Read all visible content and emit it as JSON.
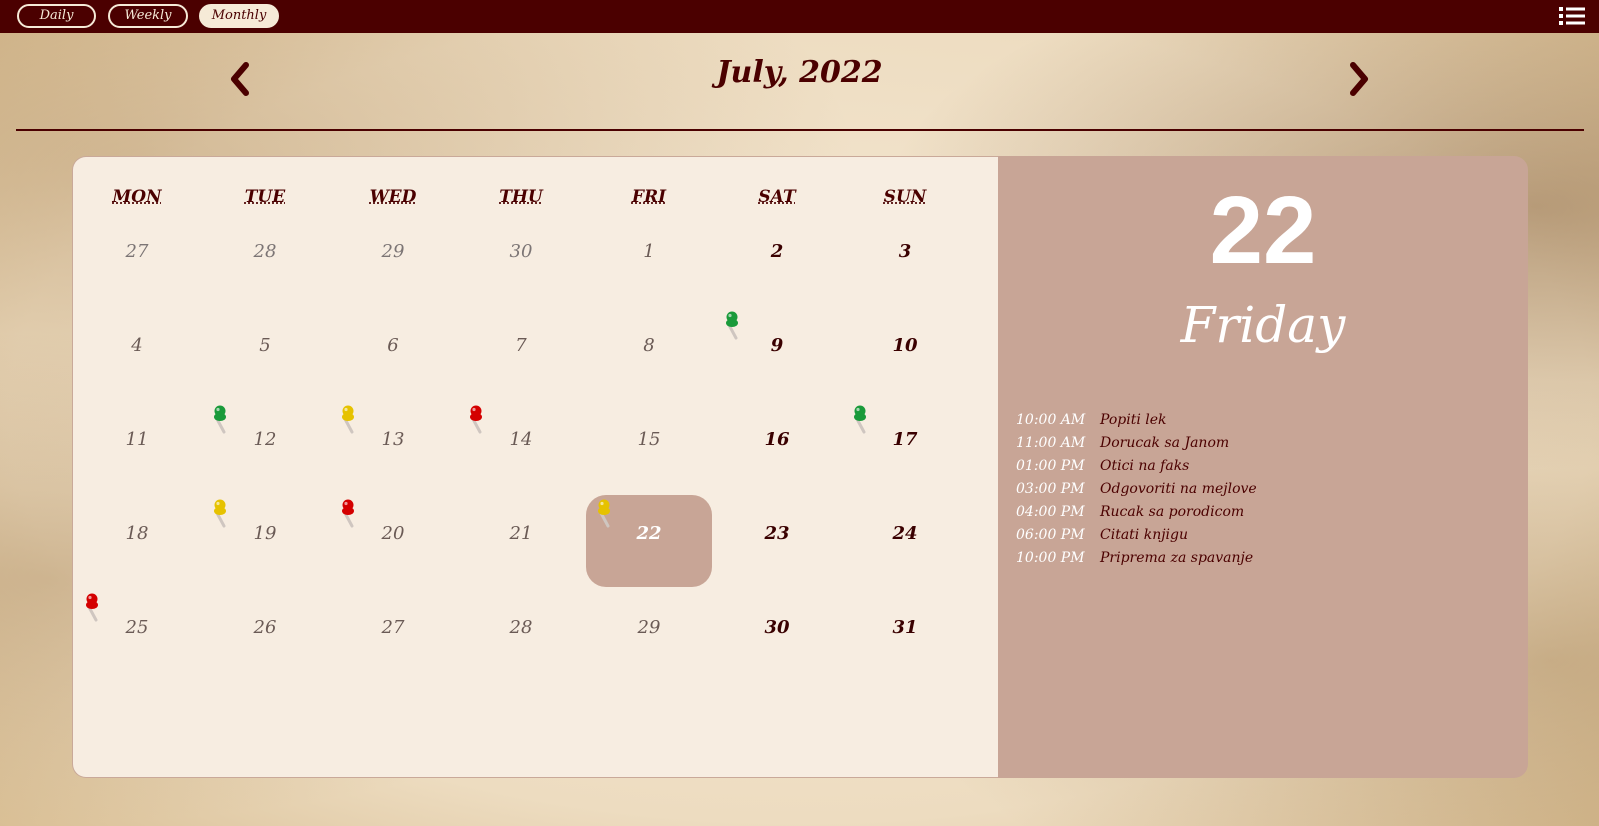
{
  "toolbar": {
    "views": [
      {
        "label": "Daily",
        "active": false
      },
      {
        "label": "Weekly",
        "active": false
      },
      {
        "label": "Monthly",
        "active": true
      }
    ],
    "menu_icon": "list-icon"
  },
  "header": {
    "month_title": "July, 2022",
    "prev_icon": "chevron-left-icon",
    "next_icon": "chevron-right-icon"
  },
  "calendar": {
    "weekdays": [
      "MON",
      "TUE",
      "WED",
      "THU",
      "FRI",
      "SAT",
      "SUN"
    ],
    "weeks": [
      [
        {
          "day": "27",
          "type": "other"
        },
        {
          "day": "28",
          "type": "other"
        },
        {
          "day": "29",
          "type": "other"
        },
        {
          "day": "30",
          "type": "other"
        },
        {
          "day": "1",
          "type": "normal"
        },
        {
          "day": "2",
          "type": "weekend"
        },
        {
          "day": "3",
          "type": "weekend"
        }
      ],
      [
        {
          "day": "4",
          "type": "normal"
        },
        {
          "day": "5",
          "type": "normal"
        },
        {
          "day": "6",
          "type": "normal"
        },
        {
          "day": "7",
          "type": "normal"
        },
        {
          "day": "8",
          "type": "normal"
        },
        {
          "day": "9",
          "type": "weekend",
          "pin": "green"
        },
        {
          "day": "10",
          "type": "weekend"
        }
      ],
      [
        {
          "day": "11",
          "type": "normal"
        },
        {
          "day": "12",
          "type": "normal",
          "pin": "green"
        },
        {
          "day": "13",
          "type": "normal",
          "pin": "yellow"
        },
        {
          "day": "14",
          "type": "normal",
          "pin": "red"
        },
        {
          "day": "15",
          "type": "normal"
        },
        {
          "day": "16",
          "type": "weekend"
        },
        {
          "day": "17",
          "type": "weekend",
          "pin": "green"
        }
      ],
      [
        {
          "day": "18",
          "type": "normal"
        },
        {
          "day": "19",
          "type": "normal",
          "pin": "yellow"
        },
        {
          "day": "20",
          "type": "normal",
          "pin": "red"
        },
        {
          "day": "21",
          "type": "normal"
        },
        {
          "day": "22",
          "type": "selected",
          "pin": "yellow"
        },
        {
          "day": "23",
          "type": "weekend"
        },
        {
          "day": "24",
          "type": "weekend"
        }
      ],
      [
        {
          "day": "25",
          "type": "normal",
          "pin": "red"
        },
        {
          "day": "26",
          "type": "normal"
        },
        {
          "day": "27",
          "type": "normal"
        },
        {
          "day": "28",
          "type": "normal"
        },
        {
          "day": "29",
          "type": "normal"
        },
        {
          "day": "30",
          "type": "weekend"
        },
        {
          "day": "31",
          "type": "weekend"
        }
      ]
    ],
    "pin_colors": {
      "green": "#1a9a3a",
      "yellow": "#e6c200",
      "red": "#d40000"
    }
  },
  "detail": {
    "date": "22",
    "weekday": "Friday",
    "events": [
      {
        "time": "10:00 AM",
        "text": "Popiti lek"
      },
      {
        "time": "11:00 AM",
        "text": "Dorucak sa Janom"
      },
      {
        "time": "01:00 PM",
        "text": "Otici na faks"
      },
      {
        "time": "03:00 PM",
        "text": "Odgovoriti na mejlove"
      },
      {
        "time": "04:00 PM",
        "text": "Rucak sa porodicom"
      },
      {
        "time": "06:00 PM",
        "text": "Citati knjigu"
      },
      {
        "time": "10:00 PM",
        "text": "Priprema za spavanje"
      }
    ]
  },
  "colors": {
    "accent": "#4b0000",
    "panel": "#c8a596",
    "calendar_bg": "#f7ede1"
  }
}
